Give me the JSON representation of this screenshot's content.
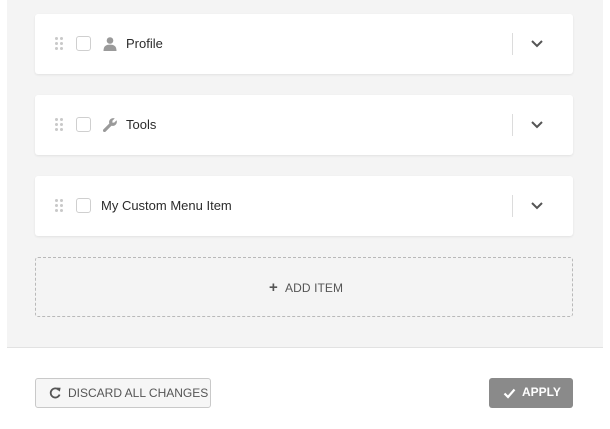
{
  "menu_items": [
    {
      "label": "Profile",
      "icon": "user-icon"
    },
    {
      "label": "Tools",
      "icon": "wrench-icon"
    },
    {
      "label": "My Custom Menu Item",
      "icon": null
    }
  ],
  "add_item": {
    "icon": "+",
    "label": "ADD ITEM"
  },
  "footer": {
    "discard_label": "DISCARD ALL CHANGES",
    "apply_label": "APPLY"
  },
  "colors": {
    "panel_bg": "#f4f4f4",
    "card_bg": "#ffffff",
    "apply_bg": "#8a8a8a",
    "text": "#2b2b2b"
  }
}
